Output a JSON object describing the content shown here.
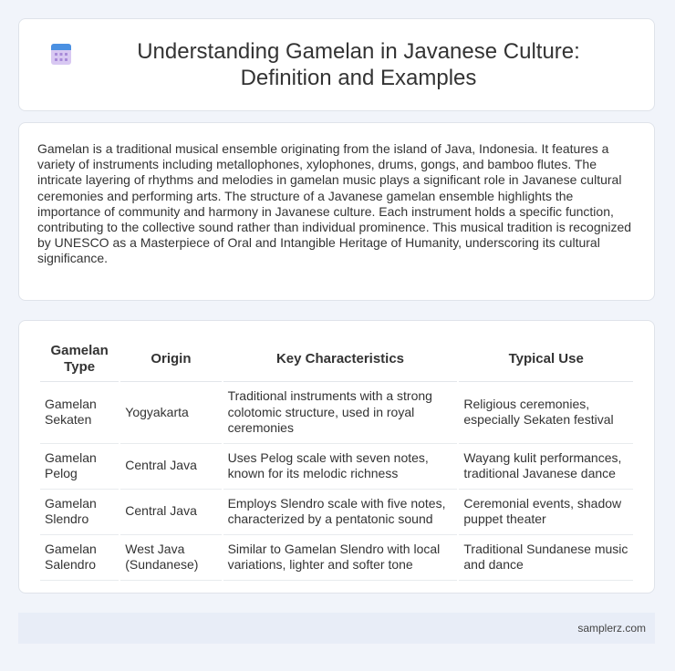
{
  "header": {
    "title": "Understanding Gamelan in Javanese Culture: Definition and Examples",
    "icon": "calendar-icon"
  },
  "intro": {
    "text": "Gamelan is a traditional musical ensemble originating from the island of Java, Indonesia. It features a variety of instruments including metallophones, xylophones, drums, gongs, and bamboo flutes. The intricate layering of rhythms and melodies in gamelan music plays a significant role in Javanese cultural ceremonies and performing arts. The structure of a Javanese gamelan ensemble highlights the importance of community and harmony in Javanese culture. Each instrument holds a specific function, contributing to the collective sound rather than individual prominence. This musical tradition is recognized by UNESCO as a Masterpiece of Oral and Intangible Heritage of Humanity, underscoring its cultural significance."
  },
  "table": {
    "headers": [
      "Gamelan Type",
      "Origin",
      "Key Characteristics",
      "Typical Use"
    ],
    "rows": [
      [
        "Gamelan Sekaten",
        "Yogyakarta",
        "Traditional instruments with a strong colotomic structure, used in royal ceremonies",
        "Religious ceremonies, especially Sekaten festival"
      ],
      [
        "Gamelan Pelog",
        "Central Java",
        "Uses Pelog scale with seven notes, known for its melodic richness",
        "Wayang kulit performances, traditional Javanese dance"
      ],
      [
        "Gamelan Slendro",
        "Central Java",
        "Employs Slendro scale with five notes, characterized by a pentatonic sound",
        "Ceremonial events, shadow puppet theater"
      ],
      [
        "Gamelan Salendro",
        "West Java (Sundanese)",
        "Similar to Gamelan Slendro with local variations, lighter and softer tone",
        "Traditional Sundanese music and dance"
      ]
    ]
  },
  "footer": {
    "brand": "samplerz.com"
  },
  "colors": {
    "background": "#f1f4fa",
    "card": "#ffffff",
    "icon_top": "#4a90e2",
    "icon_body": "#c6b2ea"
  }
}
